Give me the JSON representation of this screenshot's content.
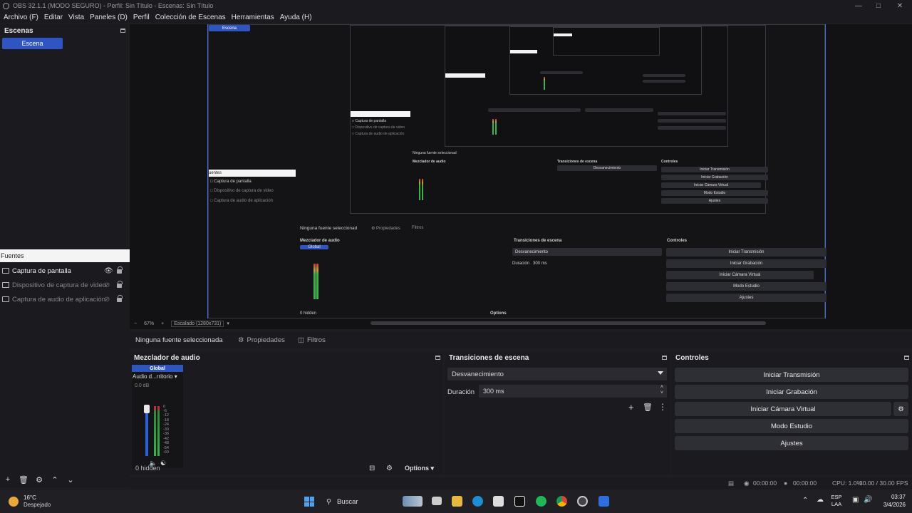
{
  "window": {
    "title": "OBS 32.1.1 (MODO SEGURO) - Perfil: Sin Título - Escenas: Sin Título"
  },
  "menu": [
    "Archivo (F)",
    "Editar",
    "Vista",
    "Paneles (D)",
    "Perfil",
    "Colección de Escenas",
    "Herramientas",
    "Ayuda (H)"
  ],
  "scenes": {
    "title": "Escenas",
    "items": [
      "Escena"
    ]
  },
  "sources": {
    "title": "Fuentes",
    "items": [
      {
        "label": "Captura de pantalla",
        "icon": "monitor-icon"
      },
      {
        "label": "Dispositivo de captura de video",
        "icon": "camera-icon"
      },
      {
        "label": "Captura de audio de aplicación",
        "icon": "app-audio-icon"
      }
    ]
  },
  "preview": {
    "zoom": "67%",
    "scale_label": "Escalado (1280x731)"
  },
  "source_toolbar": {
    "no_source": "Ninguna fuente seleccionada",
    "properties": "Propiedades",
    "filters": "Filtros"
  },
  "mixer": {
    "title": "Mezclador de audio",
    "channel_tab": "Global",
    "channel_name": "Audio d...rritorio",
    "db": "0.0 dB",
    "ticks": [
      "0",
      "-6",
      "-12",
      "-18",
      "-24",
      "-30",
      "-36",
      "-42",
      "-48",
      "-54",
      "-60"
    ],
    "hidden": "0 hidden",
    "options": "Options"
  },
  "transitions": {
    "title": "Transiciones de escena",
    "selected": "Desvanecimiento",
    "duration_label": "Duración",
    "duration_value": "300 ms"
  },
  "controls": {
    "title": "Controles",
    "buttons": [
      "Iniciar Transmisión",
      "Iniciar Grabación",
      "Iniciar Cámara Virtual",
      "Modo Estudio",
      "Ajustes"
    ]
  },
  "status": {
    "stream_time": "00:00:00",
    "rec_time": "00:00:00",
    "cpu": "CPU: 1.0%",
    "fps": "30.00 / 30.00 FPS"
  },
  "taskbar": {
    "temp": "16°C",
    "weather": "Despejado",
    "search": "Buscar",
    "lang1": "ESP",
    "lang2": "LAA",
    "time": "03:37",
    "date": "3/4/2026"
  },
  "colors": {
    "accent": "#2f55c3",
    "background": "#1b1b1f",
    "preview_border": "#3b6ee8"
  }
}
